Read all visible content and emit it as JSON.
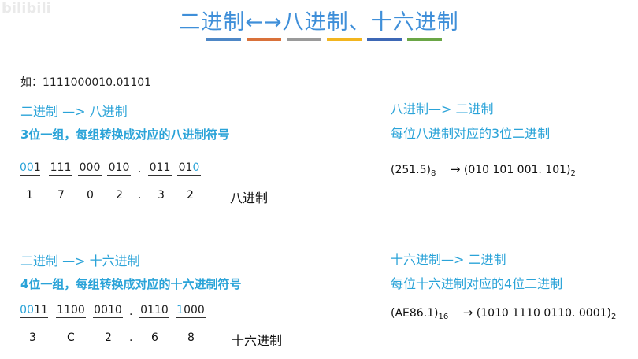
{
  "watermark": "bilibili",
  "title": "二进制←→八进制、十六进制",
  "color_bars": [
    "#4e87c6",
    "#d9713a",
    "#9a9a9a",
    "#f2b51f",
    "#3d67b5",
    "#6aa646"
  ],
  "example": "如：1111000010.01101",
  "octal_section": {
    "heading": "二进制  —>  八进制",
    "rule": "3位一组，每组转换成对应的八进制符号",
    "groups": [
      {
        "hl": "00",
        "rest": "1",
        "digit": "1"
      },
      {
        "hl": "",
        "rest": "111",
        "digit": "7"
      },
      {
        "hl": "",
        "rest": "000",
        "digit": "0"
      },
      {
        "hl": "",
        "rest": "010",
        "digit": "2"
      },
      {
        "hl": "",
        "rest": "011",
        "digit": "3"
      },
      {
        "hl": "",
        "rest": "01",
        "hl_end": "0",
        "digit": "2"
      }
    ],
    "dot": ".",
    "result_label": "八进制"
  },
  "octal_reverse": {
    "heading": "八进制—>  二进制",
    "rule": "每位八进制对应的3位二进制",
    "example_left": "(251.5)",
    "example_left_sub": "8",
    "arrow": "→",
    "example_right": "(010 101 001. 101)",
    "example_right_sub": "2"
  },
  "hex_section": {
    "heading": "二进制  —>  十六进制",
    "rule": "4位一组，每组转换成对应的十六进制符号",
    "groups": [
      {
        "hl": "00",
        "rest": "11",
        "digit": "3"
      },
      {
        "hl": "",
        "rest": "1100",
        "digit": "C"
      },
      {
        "hl": "",
        "rest": "0010",
        "digit": "2"
      },
      {
        "hl": "",
        "rest": "0110",
        "digit": "6"
      },
      {
        "hl": "",
        "rest": "1000",
        "hl_end_prefix": "1",
        "digit": "8"
      }
    ],
    "dot": ".",
    "result_label": "十六进制"
  },
  "hex_reverse": {
    "heading": "十六进制—>  二进制",
    "rule": "每位十六进制对应的4位二进制",
    "example_left": "(AE86.1)",
    "example_left_sub": "16",
    "arrow": "→",
    "example_right": "(1010 1110 0110. 0001)",
    "example_right_sub": "2"
  }
}
